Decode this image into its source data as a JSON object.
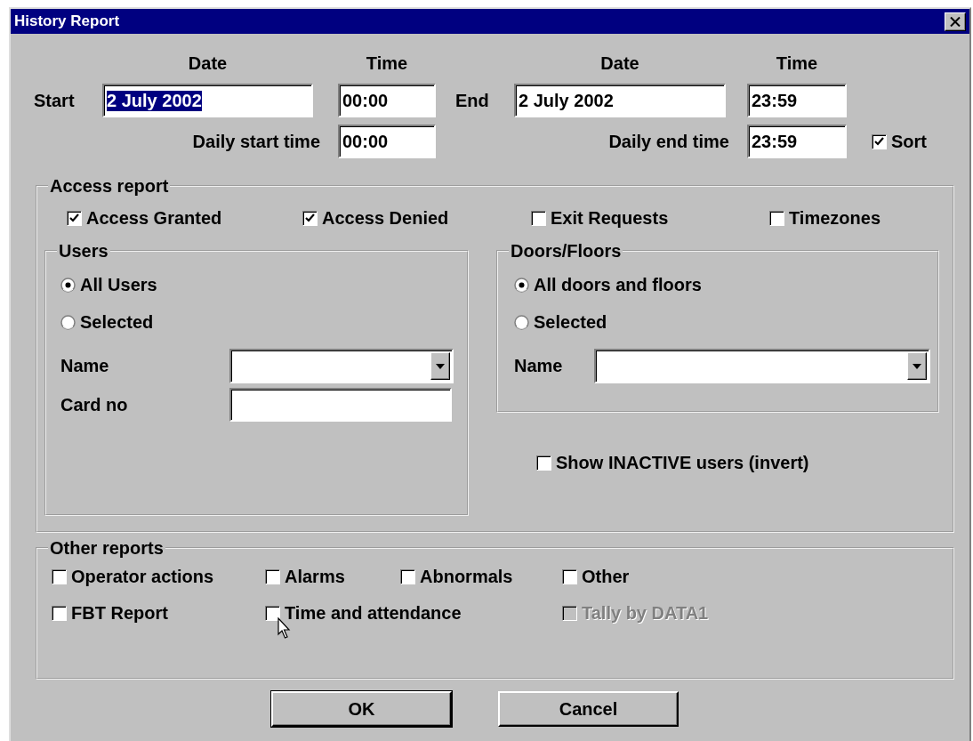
{
  "window": {
    "title": "History Report"
  },
  "headers": [
    "Date",
    "Time",
    "Date",
    "Time"
  ],
  "start": {
    "label": "Start",
    "date": "2 July 2002",
    "date_selected": true,
    "time": "00:00"
  },
  "end": {
    "label": "End",
    "date": "2 July 2002",
    "time": "23:59"
  },
  "daily_start": {
    "label": "Daily start time",
    "value": "00:00"
  },
  "daily_end": {
    "label": "Daily end time",
    "value": "23:59"
  },
  "sort": {
    "label": "Sort",
    "checked": true
  },
  "access_report": {
    "title": "Access report",
    "options": [
      {
        "label": "Access Granted",
        "checked": true
      },
      {
        "label": "Access Denied",
        "checked": true
      },
      {
        "label": "Exit Requests",
        "checked": false
      },
      {
        "label": "Timezones",
        "checked": false
      }
    ],
    "users": {
      "title": "Users",
      "options": [
        {
          "label": "All Users",
          "selected": true
        },
        {
          "label": "Selected",
          "selected": false
        }
      ],
      "name_label": "Name",
      "card_label": "Card no"
    },
    "doors": {
      "title": "Doors/Floors",
      "options": [
        {
          "label": "All doors and floors",
          "selected": true
        },
        {
          "label": "Selected",
          "selected": false
        }
      ],
      "name_label": "Name"
    },
    "show_inactive": {
      "label": "Show INACTIVE users (invert)",
      "checked": false
    }
  },
  "other_reports": {
    "title": "Other reports",
    "rows": [
      [
        {
          "label": "Operator actions",
          "checked": false,
          "disabled": false
        },
        {
          "label": "Alarms",
          "checked": false,
          "disabled": false
        },
        {
          "label": "Abnormals",
          "checked": false,
          "disabled": false
        },
        {
          "label": "Other",
          "checked": false,
          "disabled": false
        }
      ],
      [
        {
          "label": "FBT Report",
          "checked": false,
          "disabled": false
        },
        {
          "label": "Time and attendance",
          "checked": false,
          "disabled": false
        },
        null,
        {
          "label": "Tally by DATA1",
          "checked": false,
          "disabled": true
        }
      ]
    ]
  },
  "buttons": [
    "OK",
    "Cancel"
  ]
}
